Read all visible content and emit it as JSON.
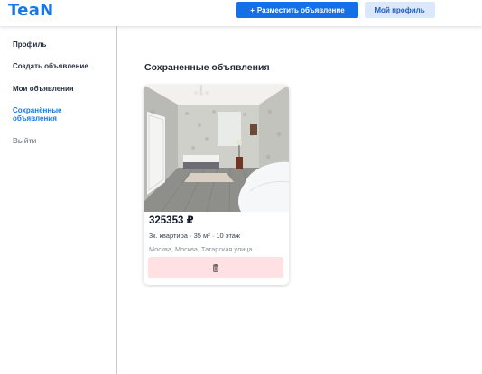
{
  "header": {
    "logo": "TeaN",
    "post_button_plus": "+",
    "post_button_label": "Разместить объявление",
    "profile_button_label": "Мой профиль"
  },
  "sidebar": {
    "items": [
      {
        "label": "Профиль"
      },
      {
        "label": "Создать объявление"
      },
      {
        "label": "Мои объявления"
      },
      {
        "label": "Сохранённые объявления"
      },
      {
        "label": "Выйти"
      }
    ]
  },
  "main": {
    "title": "Сохраненные объявления",
    "listings": [
      {
        "price": "325353 ₽",
        "specs": "3к. квартира · 35 м² · 10 этаж",
        "address": "Москва, Москва, Татарская улица...",
        "remove_icon": "trash-icon"
      }
    ]
  },
  "colors": {
    "brand": "#1877e6",
    "primary_button": "#1470e8",
    "secondary_button_bg": "#dbe8fb",
    "remove_button_bg": "#ffe0e3"
  }
}
